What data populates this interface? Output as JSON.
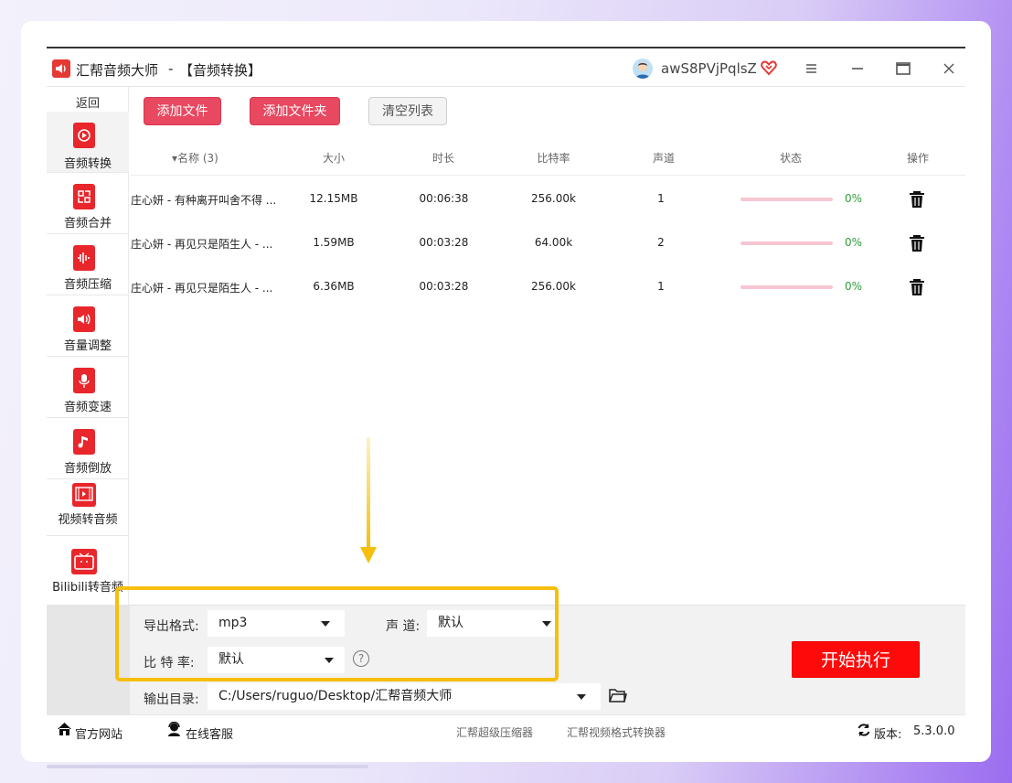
{
  "title_bar": {
    "app_name": "汇帮音频大师",
    "separator": "-",
    "module": "【音频转换】",
    "username": "awS8PVjPqlsZ",
    "icons": [
      "speaker-icon",
      "avatar",
      "vip-heart-icon",
      "menu-icon",
      "minimize-icon",
      "maximize-icon",
      "close-icon"
    ]
  },
  "sidebar": {
    "back_label": "返回",
    "items": [
      {
        "label": "音频转换",
        "icon": "audio-convert-icon",
        "active": true
      },
      {
        "label": "音频合并",
        "icon": "audio-merge-icon"
      },
      {
        "label": "音频压缩",
        "icon": "audio-compress-icon"
      },
      {
        "label": "音量调整",
        "icon": "volume-icon"
      },
      {
        "label": "音频变速",
        "icon": "microphone-icon"
      },
      {
        "label": "音频倒放",
        "icon": "music-note-icon"
      },
      {
        "label": "视频转音频",
        "icon": "film-icon"
      },
      {
        "label": "Bilibili转音频",
        "icon": "tv-icon"
      }
    ]
  },
  "toolbar": {
    "add_file": "添加文件",
    "add_folder": "添加文件夹",
    "clear_list": "清空列表"
  },
  "table": {
    "columns": [
      "名称 (3)",
      "大小",
      "时长",
      "比特率",
      "声道",
      "状态",
      "操作"
    ],
    "rows": [
      {
        "name": "庄心妍 - 有种离开叫舍不得 ...",
        "size": "12.15MB",
        "duration": "00:06:38",
        "bitrate": "256.00k",
        "channels": "1",
        "progress": 0,
        "status": "0%"
      },
      {
        "name": "庄心妍 - 再见只是陌生人 - ...",
        "size": "1.59MB",
        "duration": "00:03:28",
        "bitrate": "64.00k",
        "channels": "2",
        "progress": 0,
        "status": "0%"
      },
      {
        "name": "庄心妍 - 再见只是陌生人 - ...",
        "size": "6.36MB",
        "duration": "00:03:28",
        "bitrate": "256.00k",
        "channels": "1",
        "progress": 0,
        "status": "0%"
      }
    ]
  },
  "settings": {
    "format_label": "导出格式:",
    "format_value": "mp3",
    "channel_label": "声 道:",
    "channel_value": "默认",
    "bitrate_label": "比 特 率:",
    "bitrate_value": "默认",
    "help": "?",
    "output_label": "输出目录:",
    "output_value": "C:/Users/ruguo/Desktop/汇帮音频大师",
    "start_button": "开始执行"
  },
  "footer": {
    "website": "官方网站",
    "support": "在线客服",
    "link1": "汇帮超级压缩器",
    "link2": "汇帮视频格式转换器",
    "version_label": "版本:",
    "version": "5.3.0.0"
  },
  "colors": {
    "accent_red": "#e84860",
    "start_red": "#ff0a0a",
    "highlight_yellow": "#f6bf0e",
    "progress_track": "#f8c6d2",
    "percent_green": "#2e9e3a"
  }
}
